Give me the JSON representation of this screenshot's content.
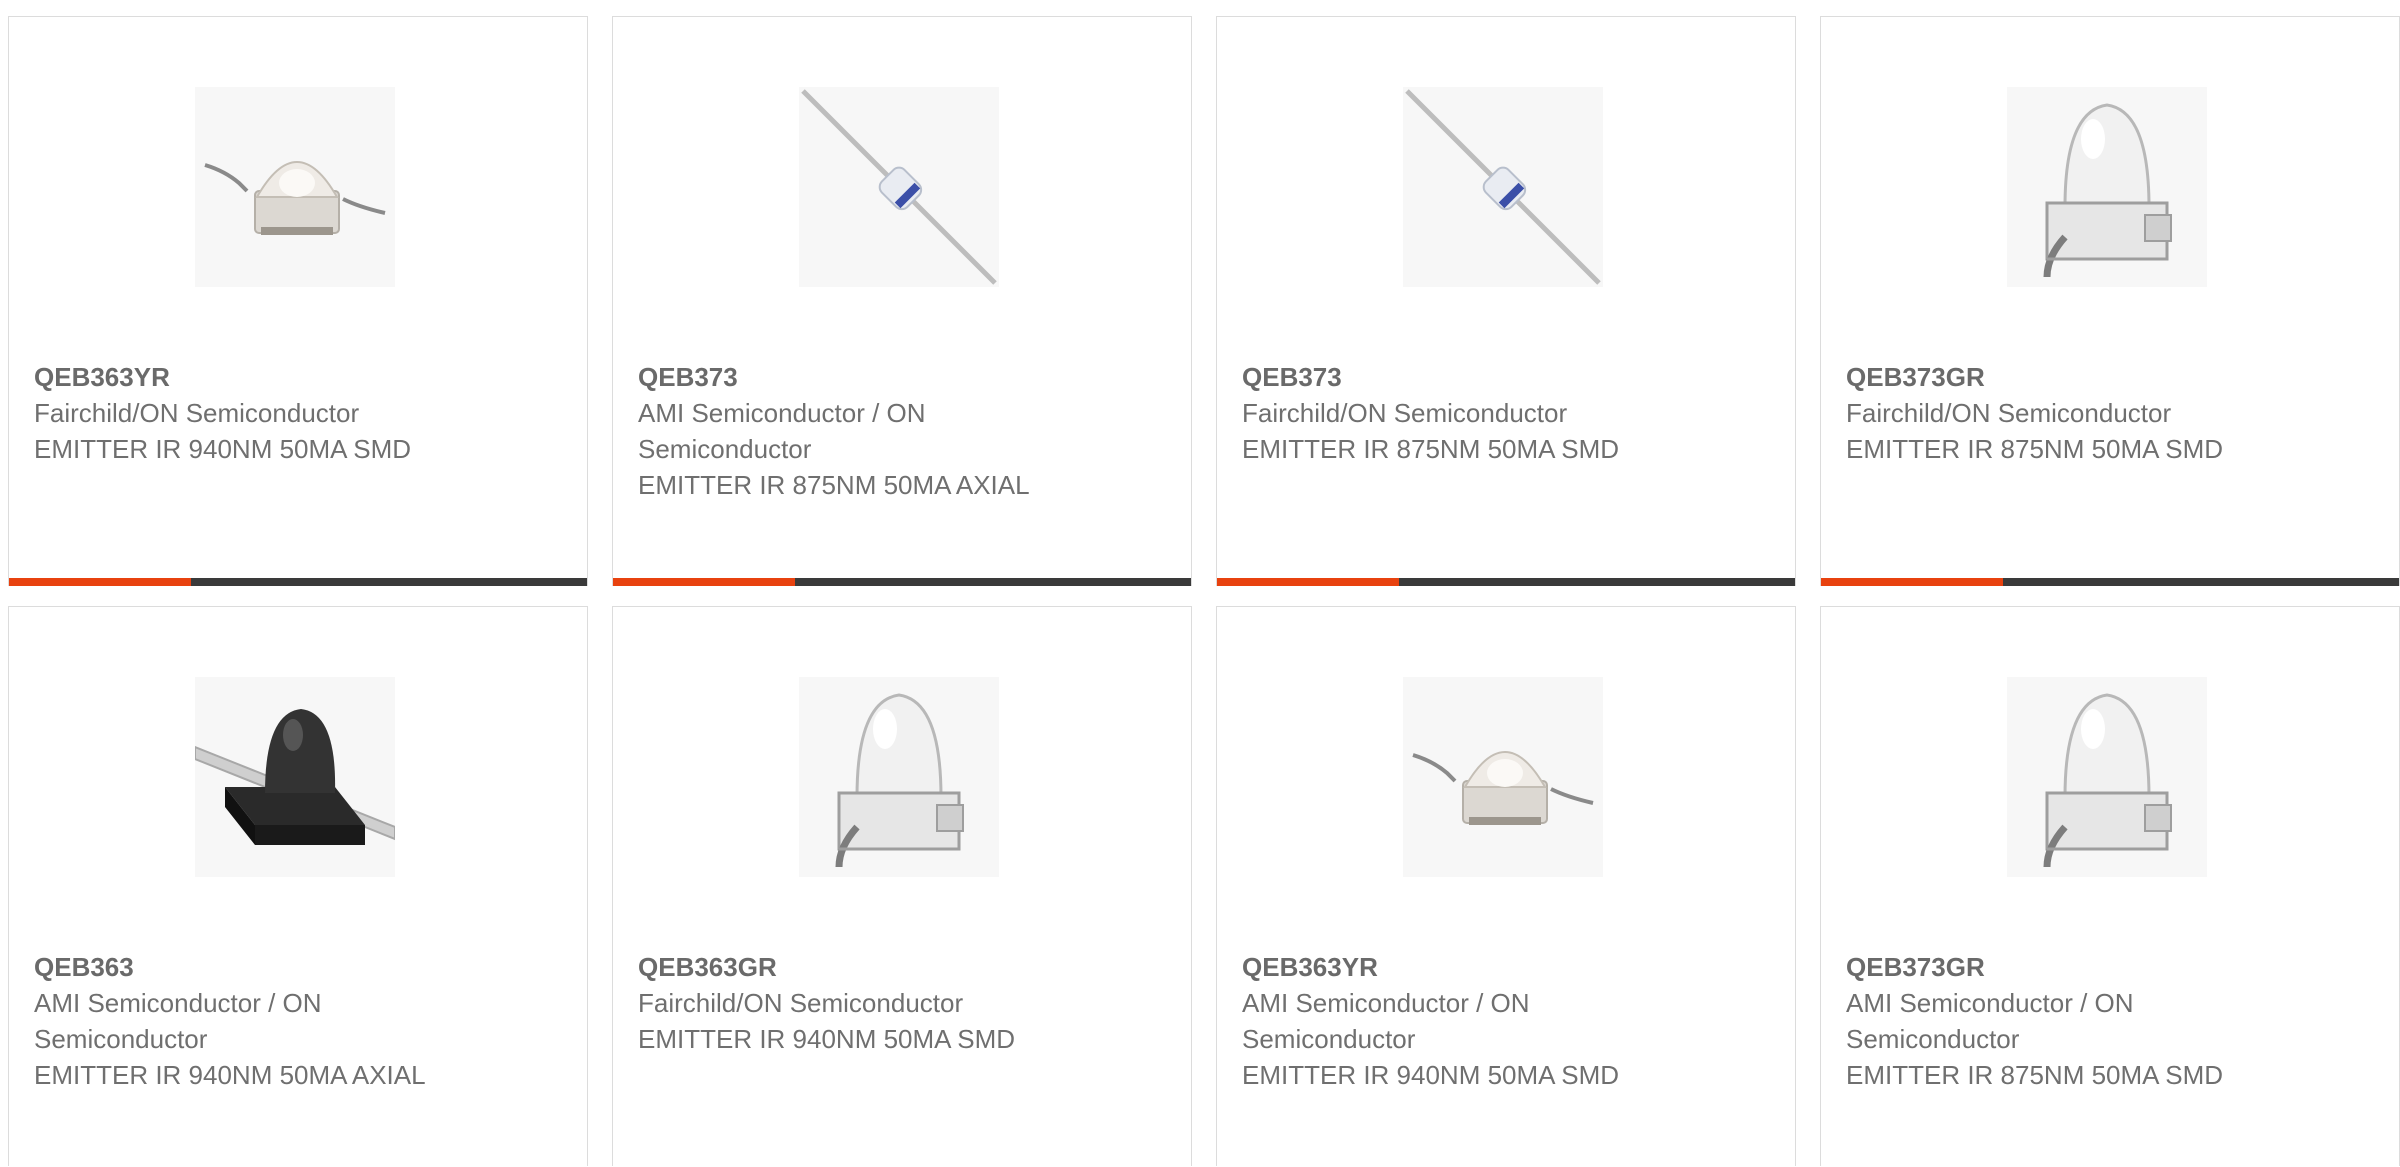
{
  "accent_color": "#e8420f",
  "bar_color": "#3a3a3a",
  "products": [
    {
      "part_number": "QEB363YR",
      "manufacturer": "Fairchild/ON Semiconductor",
      "description": "EMITTER IR 940NM 50MA SMD",
      "image_icon": "smd-emitter-clear-icon"
    },
    {
      "part_number": "QEB373",
      "manufacturer": "AMI Semiconductor / ON Semiconductor",
      "description": "EMITTER IR 875NM 50MA AXIAL",
      "image_icon": "axial-emitter-icon"
    },
    {
      "part_number": "QEB373",
      "manufacturer": "Fairchild/ON Semiconductor",
      "description": "EMITTER IR 875NM 50MA SMD",
      "image_icon": "axial-emitter-icon"
    },
    {
      "part_number": "QEB373GR",
      "manufacturer": "Fairchild/ON Semiconductor",
      "description": "EMITTER IR 875NM 50MA SMD",
      "image_icon": "smd-emitter-dome-icon"
    },
    {
      "part_number": "QEB363",
      "manufacturer": "AMI Semiconductor / ON Semiconductor",
      "description": "EMITTER IR 940NM 50MA AXIAL",
      "image_icon": "black-axial-emitter-icon"
    },
    {
      "part_number": "QEB363GR",
      "manufacturer": "Fairchild/ON Semiconductor",
      "description": "EMITTER IR 940NM 50MA SMD",
      "image_icon": "smd-emitter-dome-icon"
    },
    {
      "part_number": "QEB363YR",
      "manufacturer": "AMI Semiconductor / ON Semiconductor",
      "description": "EMITTER IR 940NM 50MA SMD",
      "image_icon": "smd-emitter-clear-icon"
    },
    {
      "part_number": "QEB373GR",
      "manufacturer": "AMI Semiconductor / ON Semiconductor",
      "description": "EMITTER IR 875NM 50MA SMD",
      "image_icon": "smd-emitter-dome-icon"
    }
  ]
}
